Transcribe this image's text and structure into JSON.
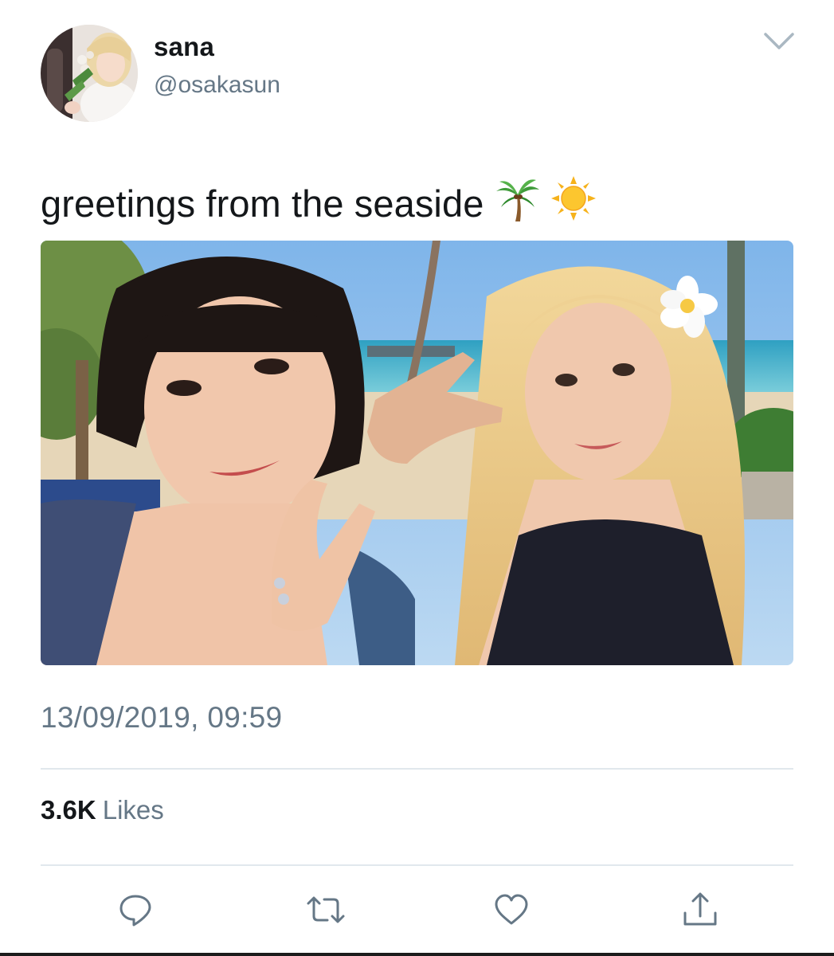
{
  "tweet": {
    "author": {
      "display_name": "sana",
      "handle": "@osakasun",
      "avatar_icon": "profile-photo"
    },
    "text": "greetings from the seaside",
    "text_emojis": [
      "palm-tree-icon",
      "sun-icon"
    ],
    "photo": {
      "alt_icon": "beach-selfie-photo"
    },
    "timestamp": "13/09/2019, 09:59",
    "likes": {
      "count": "3.6K",
      "label": "Likes"
    },
    "actions": [
      "reply-icon",
      "retweet-icon",
      "like-icon",
      "share-icon"
    ]
  },
  "colors": {
    "text_primary": "#14171a",
    "text_secondary": "#657786",
    "divider": "#e1e8ed",
    "icon": "#657786"
  }
}
